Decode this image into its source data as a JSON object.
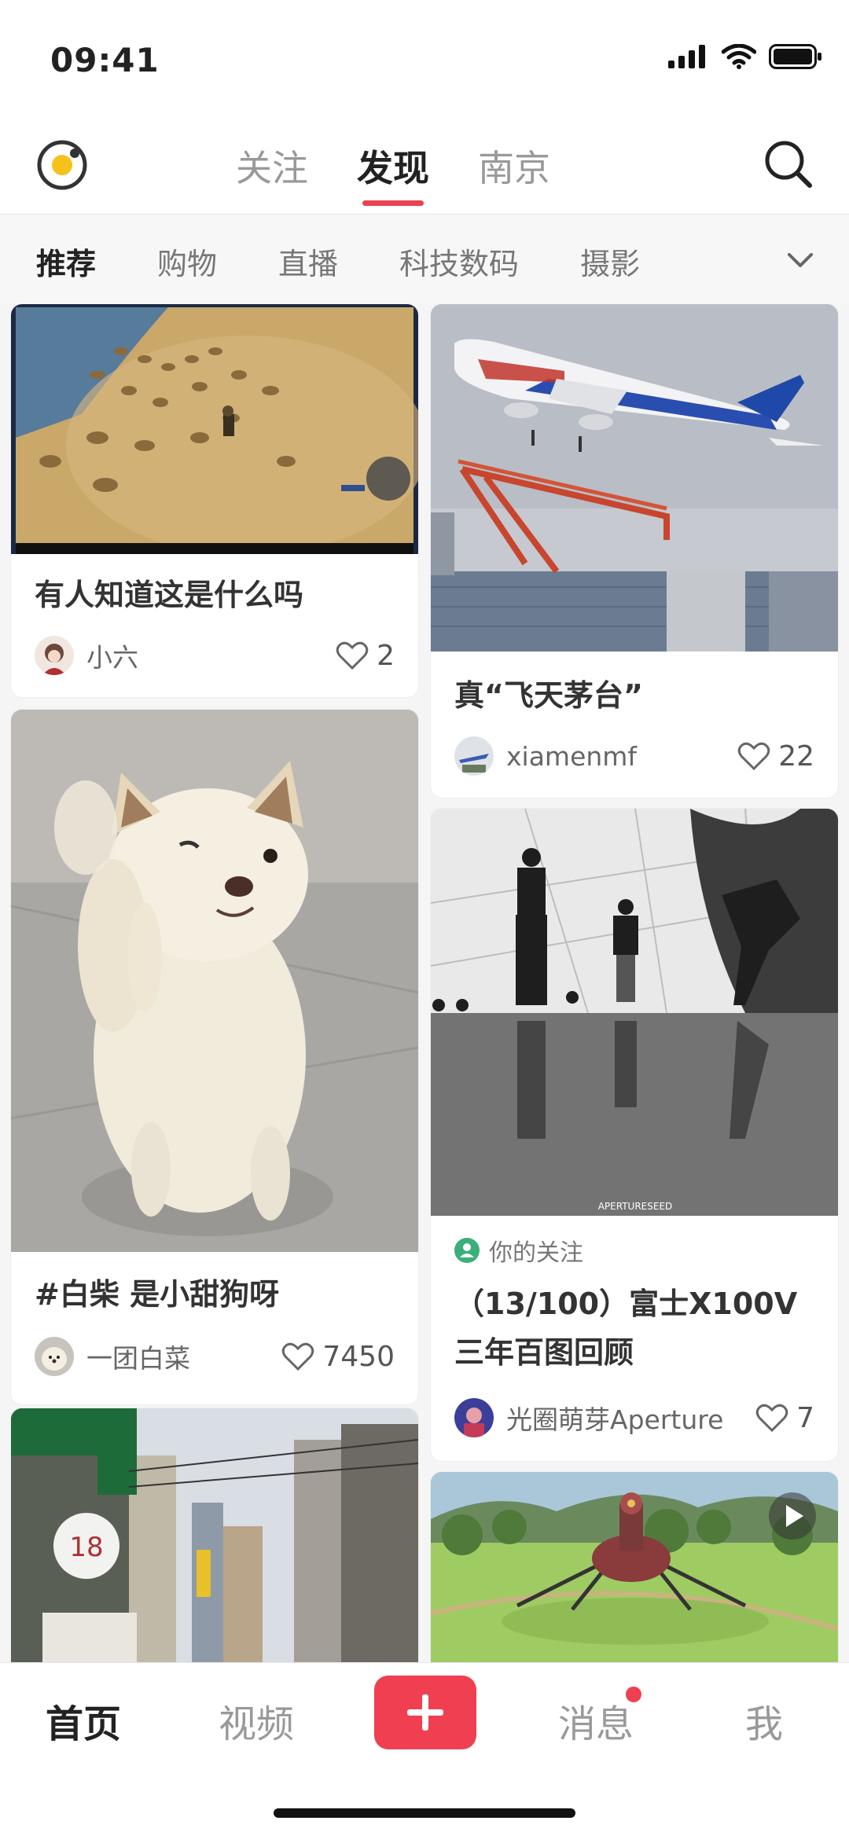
{
  "status_bar": {
    "time": "09:41"
  },
  "top_nav": {
    "tabs": [
      {
        "label": "关注"
      },
      {
        "label": "发现"
      },
      {
        "label": "南京"
      }
    ],
    "active_tab": "发现"
  },
  "categories": {
    "items": [
      "推荐",
      "购物",
      "直播",
      "科技数码",
      "摄影"
    ],
    "active": "推荐"
  },
  "feed": {
    "left": [
      {
        "title": "有人知道这是什么吗",
        "author": "小六",
        "likes": "2"
      },
      {
        "title": "#白柴 是小甜狗呀",
        "author": "一团白菜",
        "likes": "7450"
      }
    ],
    "right": [
      {
        "title": "真“飞天茅台”",
        "author": "xiamenmf",
        "likes": "22"
      },
      {
        "follow_tag": "你的关注",
        "title_line1": "（13/100）富士X100V",
        "title_line2": "三年百图回顾",
        "author": "光圈萌芽Aperture",
        "likes": "7"
      }
    ],
    "image_watermark": "APERTURESEED",
    "sign_number": "18"
  },
  "bottom_nav": {
    "items": [
      "首页",
      "视频",
      "消息",
      "我"
    ],
    "active": "首页"
  },
  "colors": {
    "accent": "#ef3f50",
    "text": "#222222",
    "muted": "#999999"
  }
}
